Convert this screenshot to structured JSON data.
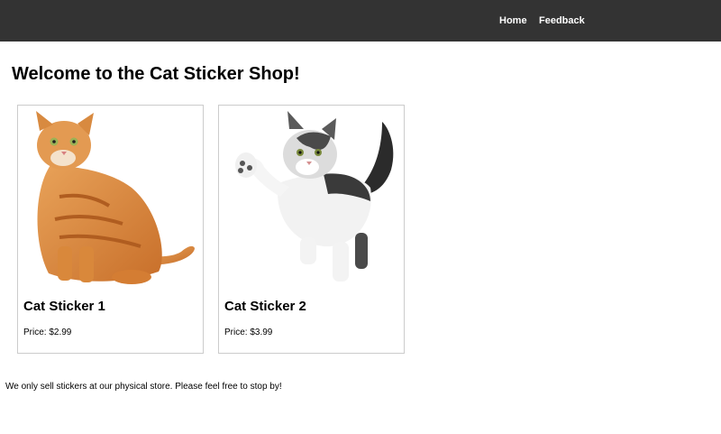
{
  "nav": {
    "links": [
      {
        "label": "Home"
      },
      {
        "label": "Feedback"
      }
    ]
  },
  "main": {
    "title": "Welcome to the Cat Sticker Shop!",
    "products": [
      {
        "name": "Cat Sticker 1",
        "price": "Price: $2.99",
        "image": "orange-tabby-cat-photo"
      },
      {
        "name": "Cat Sticker 2",
        "price": "Price: $3.99",
        "image": "black-white-kitten-photo"
      }
    ],
    "note": "We only sell stickers at our physical store. Please feel free to stop by!"
  },
  "colors": {
    "navbar": "#333333",
    "nav_text": "#ffffff",
    "card_border": "#cccccc"
  }
}
